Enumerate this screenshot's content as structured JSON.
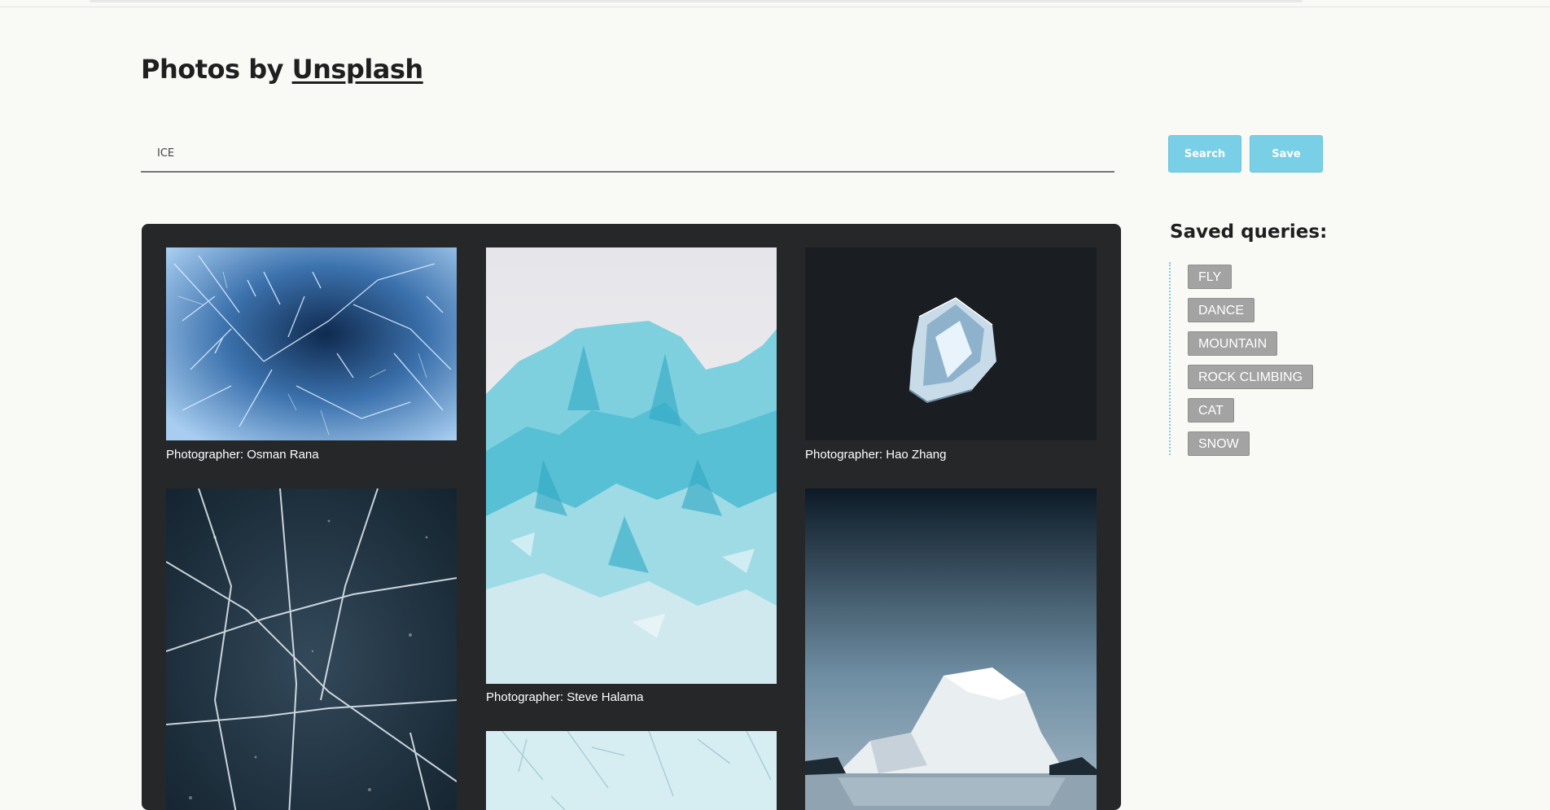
{
  "header": {
    "title_prefix": "Photos by ",
    "title_link": "Unsplash"
  },
  "search": {
    "value": "ICE",
    "search_label": "Search",
    "save_label": "Save"
  },
  "gallery": {
    "photos": [
      {
        "caption": "Photographer: Osman Rana",
        "subject": "frost-crystals"
      },
      {
        "caption": "Photographer: Steve Halama",
        "subject": "glacier-ice"
      },
      {
        "caption": "Photographer: Hao Zhang",
        "subject": "ice-cube"
      },
      {
        "caption": "",
        "subject": "cracked-ice"
      },
      {
        "caption": "",
        "subject": "iceberg"
      },
      {
        "caption": "",
        "subject": "frost-pattern"
      }
    ]
  },
  "sidebar": {
    "title": "Saved queries:",
    "queries": [
      "FLY",
      "DANCE",
      "MOUNTAIN",
      "ROCK CLIMBING",
      "CAT",
      "SNOW"
    ]
  },
  "colors": {
    "accent": "#79cfe6",
    "tag_bg": "#a3a3a3",
    "gallery_bg": "#262729",
    "page_bg": "#f9f9f6"
  }
}
